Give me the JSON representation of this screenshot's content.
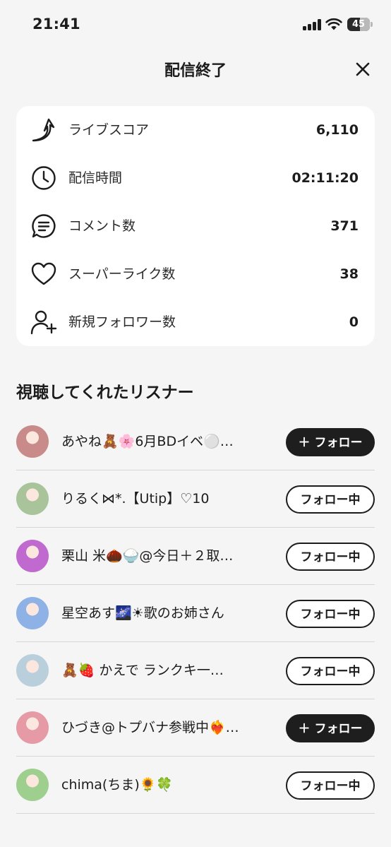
{
  "status_bar": {
    "time": "21:41",
    "battery": "45"
  },
  "header": {
    "title": "配信終了"
  },
  "stats": [
    {
      "icon": "arrow-trend-icon",
      "label": "ライブスコア",
      "value": "6,110"
    },
    {
      "icon": "clock-icon",
      "label": "配信時間",
      "value": "02:11:20"
    },
    {
      "icon": "comment-icon",
      "label": "コメント数",
      "value": "371"
    },
    {
      "icon": "heart-icon",
      "label": "スーパーライク数",
      "value": "38"
    },
    {
      "icon": "add-user-icon",
      "label": "新規フォロワー数",
      "value": "0"
    }
  ],
  "listeners_section": {
    "title": "視聴してくれたリスナー"
  },
  "listeners": [
    {
      "name": "あやね🧸🌸6月BDイベ⚪️…",
      "button": "＋ フォロー",
      "following": false,
      "avatar_color": "#c98a8a"
    },
    {
      "name": "りるく⋈*.【Utip】♡10",
      "button": "フォロー中",
      "following": true,
      "avatar_color": "#a9c49a"
    },
    {
      "name": "栗山 米🌰🍚@今日＋２取…",
      "button": "フォロー中",
      "following": true,
      "avatar_color": "#c06ad0"
    },
    {
      "name": "星空あす🌌☀歌のお姉さん",
      "button": "フォロー中",
      "following": true,
      "avatar_color": "#8fb2e6"
    },
    {
      "name": "🧸🍓 かえで ランクキ一…",
      "button": "フォロー中",
      "following": true,
      "avatar_color": "#b9d0dc"
    },
    {
      "name": "ひづき@トプバナ参戦中❤️‍🔥…",
      "button": "＋ フォロー",
      "following": false,
      "avatar_color": "#e59aa6"
    },
    {
      "name": "chima(ちま)🌻🍀",
      "button": "フォロー中",
      "following": true,
      "avatar_color": "#9fcf8f"
    }
  ]
}
